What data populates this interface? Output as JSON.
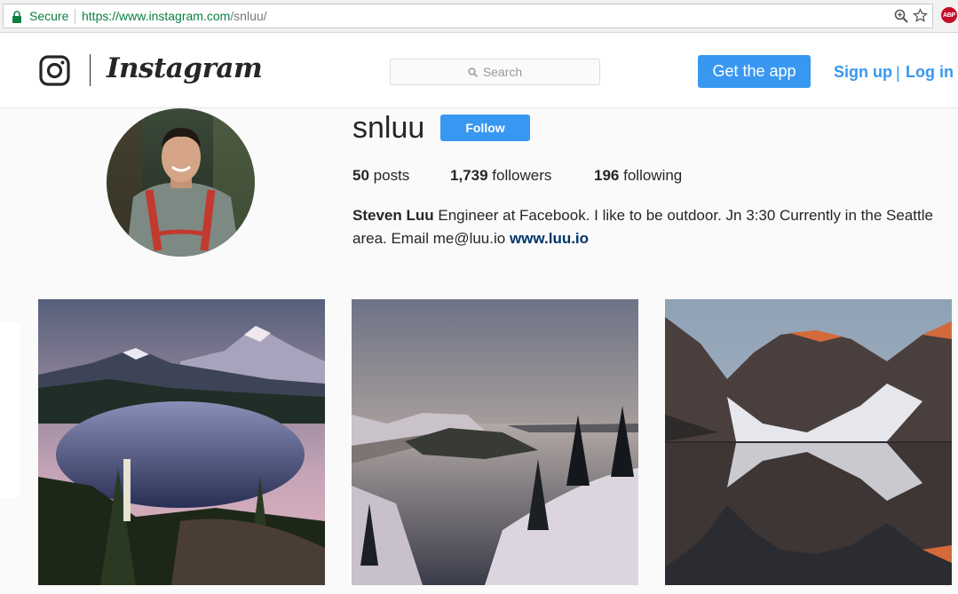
{
  "browser": {
    "secure_label": "Secure",
    "url_origin": "https://www.instagram.com",
    "url_path": "/snluu/",
    "extension_badge": "ABP"
  },
  "header": {
    "logo_text": "Instagram",
    "search_placeholder": "Search",
    "get_app_label": "Get the app",
    "signup_label": "Sign up",
    "separator": "|",
    "login_label": "Log in"
  },
  "profile": {
    "username": "snluu",
    "follow_label": "Follow",
    "posts_count": "50",
    "posts_label": "posts",
    "followers_count": "1,739",
    "followers_label": "followers",
    "following_count": "196",
    "following_label": "following",
    "full_name": "Steven Luu",
    "bio_text": "Engineer at Facebook. I like to be outdoor. Jn 3:30 Currently in the Seattle area. Email me@luu.io",
    "website": "www.luu.io"
  },
  "colors": {
    "accent": "#3897f0",
    "secure_green": "#0b8043",
    "link_dark": "#003569"
  },
  "icons": [
    "lock-icon",
    "zoom-icon",
    "star-icon",
    "instagram-glyph-icon",
    "search-icon"
  ]
}
